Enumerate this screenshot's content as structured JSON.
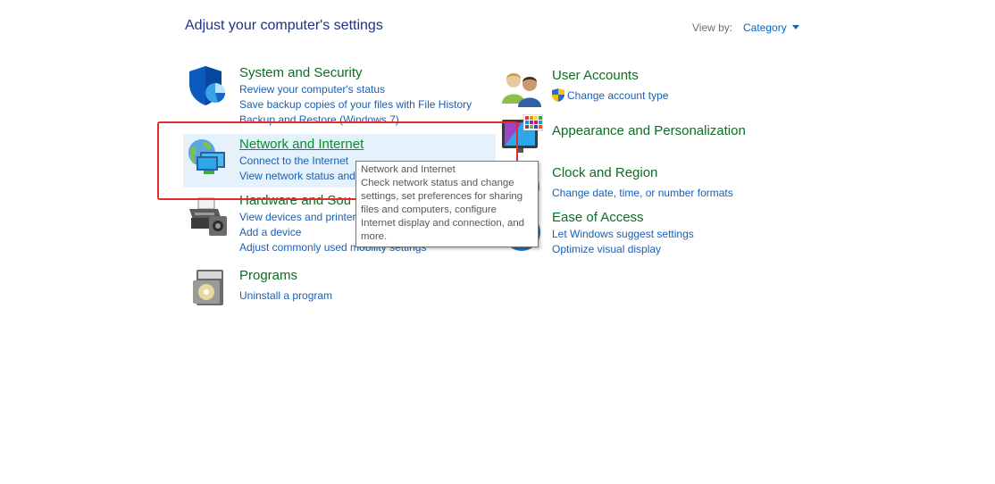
{
  "header": {
    "title": "Adjust your computer's settings",
    "view_by_label": "View by:",
    "view_by_value": "Category"
  },
  "left_categories": {
    "system_security": {
      "title": "System and Security",
      "links": [
        "Review your computer's status",
        "Save backup copies of your files with File History",
        "Backup and Restore (Windows 7)"
      ]
    },
    "network_internet": {
      "title": "Network and Internet",
      "links": [
        "Connect to the Internet",
        "View network status and"
      ]
    },
    "hardware_sound": {
      "title": "Hardware and Sou",
      "links": [
        "View devices and printers",
        "Add a device",
        "Adjust commonly used mobility settings"
      ]
    },
    "programs": {
      "title": "Programs",
      "links": [
        "Uninstall a program"
      ]
    }
  },
  "right_categories": {
    "user_accounts": {
      "title": "User Accounts",
      "links": [
        "Change account type"
      ]
    },
    "appearance": {
      "title": "Appearance and Personalization",
      "links": []
    },
    "clock_region": {
      "title": "Clock and Region",
      "links": [
        "Change date, time, or number formats"
      ]
    },
    "ease_access": {
      "title": "Ease of Access",
      "links": [
        "Let Windows suggest settings",
        "Optimize visual display"
      ]
    }
  },
  "tooltip": {
    "lines": [
      "Network and Internet",
      "Check network status and change",
      "settings, set preferences for sharing",
      "files and computers, configure",
      "Internet display and connection, and",
      "more."
    ]
  },
  "icons": {
    "system_security": "shield-icon",
    "network_internet": "network-globe-icon",
    "hardware_sound": "printer-icon",
    "programs": "programs-icon",
    "user_accounts": "users-icon",
    "appearance": "monitor-palette-icon",
    "clock_region": "clock-globe-icon",
    "ease_access": "ease-of-access-icon",
    "uac_shield": "uac-shield-icon"
  },
  "colors": {
    "title_blue": "#1e3287",
    "category_green": "#0b6e22",
    "link_blue": "#1a5fb4",
    "hover_bg": "#e5f1fb",
    "annotation_red": "#e8292a"
  }
}
